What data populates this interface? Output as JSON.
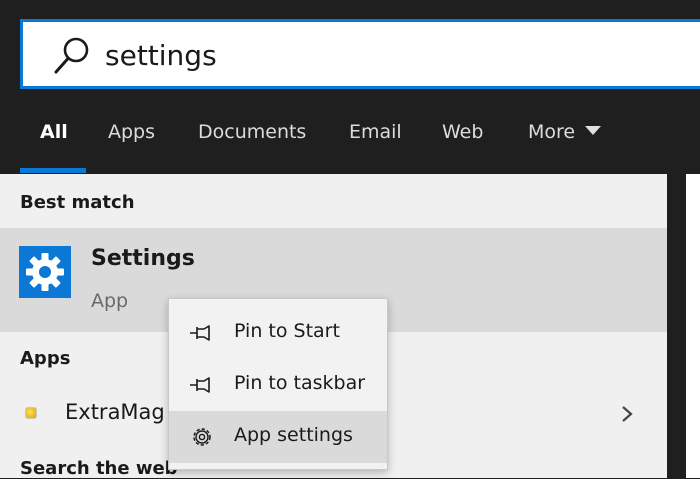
{
  "search": {
    "query": "settings"
  },
  "tabs": [
    {
      "label": "All",
      "active": true
    },
    {
      "label": "Apps"
    },
    {
      "label": "Documents"
    },
    {
      "label": "Email"
    },
    {
      "label": "Web"
    },
    {
      "label": "More"
    }
  ],
  "best_match": {
    "header": "Best match",
    "title": "Settings",
    "subtitle": "App",
    "icon": "gear-icon"
  },
  "apps_section": {
    "header": "Apps",
    "items": [
      {
        "label": "ExtraMag",
        "icon": "extramag-icon"
      }
    ]
  },
  "web_section": {
    "header": "Search the web"
  },
  "context_menu": {
    "items": [
      {
        "label": "Pin to Start",
        "icon": "pin-icon"
      },
      {
        "label": "Pin to taskbar",
        "icon": "pin-icon"
      },
      {
        "label": "App settings",
        "icon": "gear-icon"
      }
    ]
  },
  "colors": {
    "accent": "#0a78d4",
    "topbar": "#1f1f1f",
    "panel": "#f0f0f0",
    "selected_row": "#dadada"
  }
}
